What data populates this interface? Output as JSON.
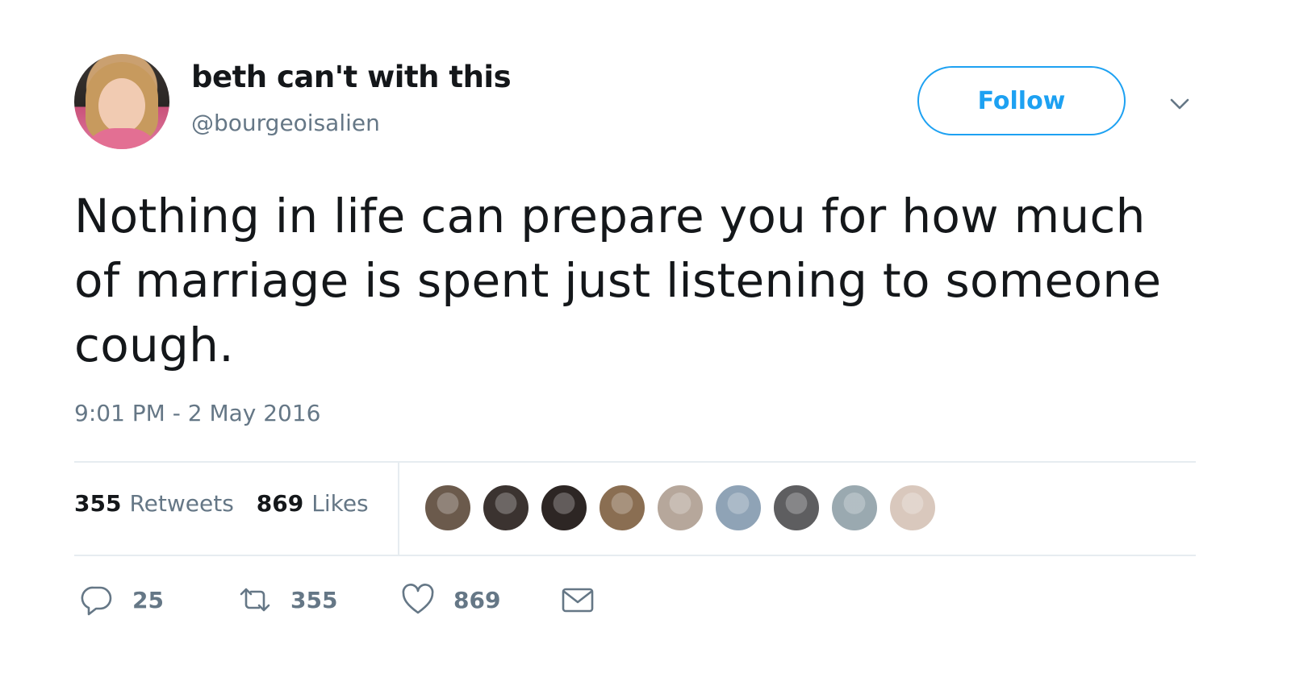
{
  "user": {
    "display_name": "beth can't with this",
    "handle": "@bourgeoisalien"
  },
  "follow_button": {
    "label": "Follow"
  },
  "tweet": {
    "text": "Nothing in life can prepare you for how much of marriage is spent just listening to someone cough.",
    "timestamp": "9:01 PM - 2 May 2016"
  },
  "stats": {
    "retweets_count": "355",
    "retweets_label": "Retweets",
    "likes_count": "869",
    "likes_label": "Likes"
  },
  "liker_avatars": [
    {
      "name": "liker-avatar-1",
      "color": "#6b5a4c"
    },
    {
      "name": "liker-avatar-2",
      "color": "#3b3330"
    },
    {
      "name": "liker-avatar-3",
      "color": "#2d2624"
    },
    {
      "name": "liker-avatar-4",
      "color": "#8a6e52"
    },
    {
      "name": "liker-avatar-5",
      "color": "#b6a79b"
    },
    {
      "name": "liker-avatar-6",
      "color": "#8fa3b6"
    },
    {
      "name": "liker-avatar-7",
      "color": "#5e5e60"
    },
    {
      "name": "liker-avatar-8",
      "color": "#9aa9b0"
    },
    {
      "name": "liker-avatar-9",
      "color": "#d9c8bd"
    }
  ],
  "actions": {
    "reply_count": "25",
    "retweet_count": "355",
    "like_count": "869"
  },
  "icons": {
    "reply": "reply-icon",
    "retweet": "retweet-icon",
    "like": "heart-icon",
    "dm": "envelope-icon",
    "more": "chevron-down-icon"
  },
  "colors": {
    "accent": "#1da1f2",
    "secondary_text": "#657786",
    "divider": "#e6ecf0"
  }
}
